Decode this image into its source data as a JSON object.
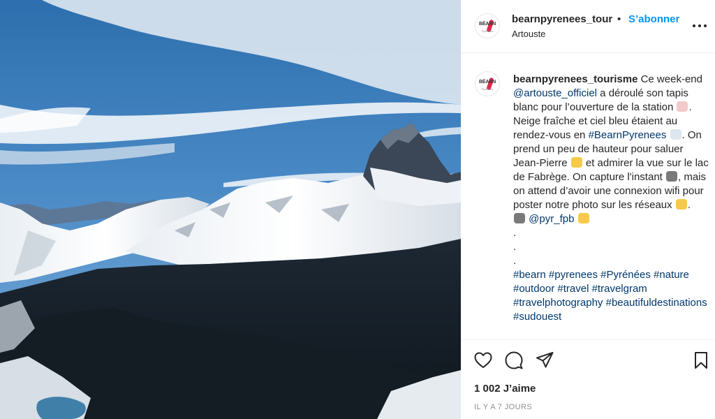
{
  "post": {
    "username": "bearnpyrenees_tourisme",
    "username_truncated": "bearnpyrenees_tour",
    "separator": "•",
    "follow_label": "S’abonner",
    "location": "Artouste",
    "avatar_logo_text": "BÉARN",
    "avatar_logo_sub": "Pyrénées",
    "more_icon": "more-horizontal-icon"
  },
  "caption": {
    "p1": " Ce week-end ",
    "mention1": "@artouste_officiel",
    "p2": " a déroulé son tapis blanc pour l’ouverture de la station ",
    "p3": ". Neige fraîche et ciel bleu étaient au rendez-vous en ",
    "hashtag_main": "#BearnPyrenees",
    "p4": ". On prend un peu de hauteur pour saluer Jean-Pierre ",
    "p5": " et admirer la vue sur le lac de Fabrège. On capture l'instant ",
    "p6": ", mais on attend d’avoir une connexion wifi pour poster notre photo sur les réseaux ",
    "p7": ".",
    "mention2": "@pyr_fpb",
    "dots": [
      ".",
      ".",
      "."
    ],
    "hashtags": [
      "#bearn",
      "#pyrenees",
      "#Pyrénées",
      "#nature",
      "#outdoor",
      "#travel",
      "#travelgram",
      "#travelphotography",
      "#beautifuldestinations",
      "#sudouest"
    ],
    "emoji_colors": {
      "skier": "#f2c9c9",
      "snowman": "#dde6ef",
      "wave": "#f6c94a",
      "camera": "#7a7a7a",
      "smirk": "#f6c94a",
      "clap": "#f6c94a"
    }
  },
  "actions": {
    "icons": [
      "heart-icon",
      "comment-icon",
      "share-icon",
      "bookmark-icon"
    ],
    "likes": "1 002 J’aime",
    "timestamp": "IL Y A 7 JOURS"
  },
  "colors": {
    "link": "#00376b",
    "follow": "#0095f6",
    "text": "#262626",
    "muted": "#8e8e8e"
  }
}
